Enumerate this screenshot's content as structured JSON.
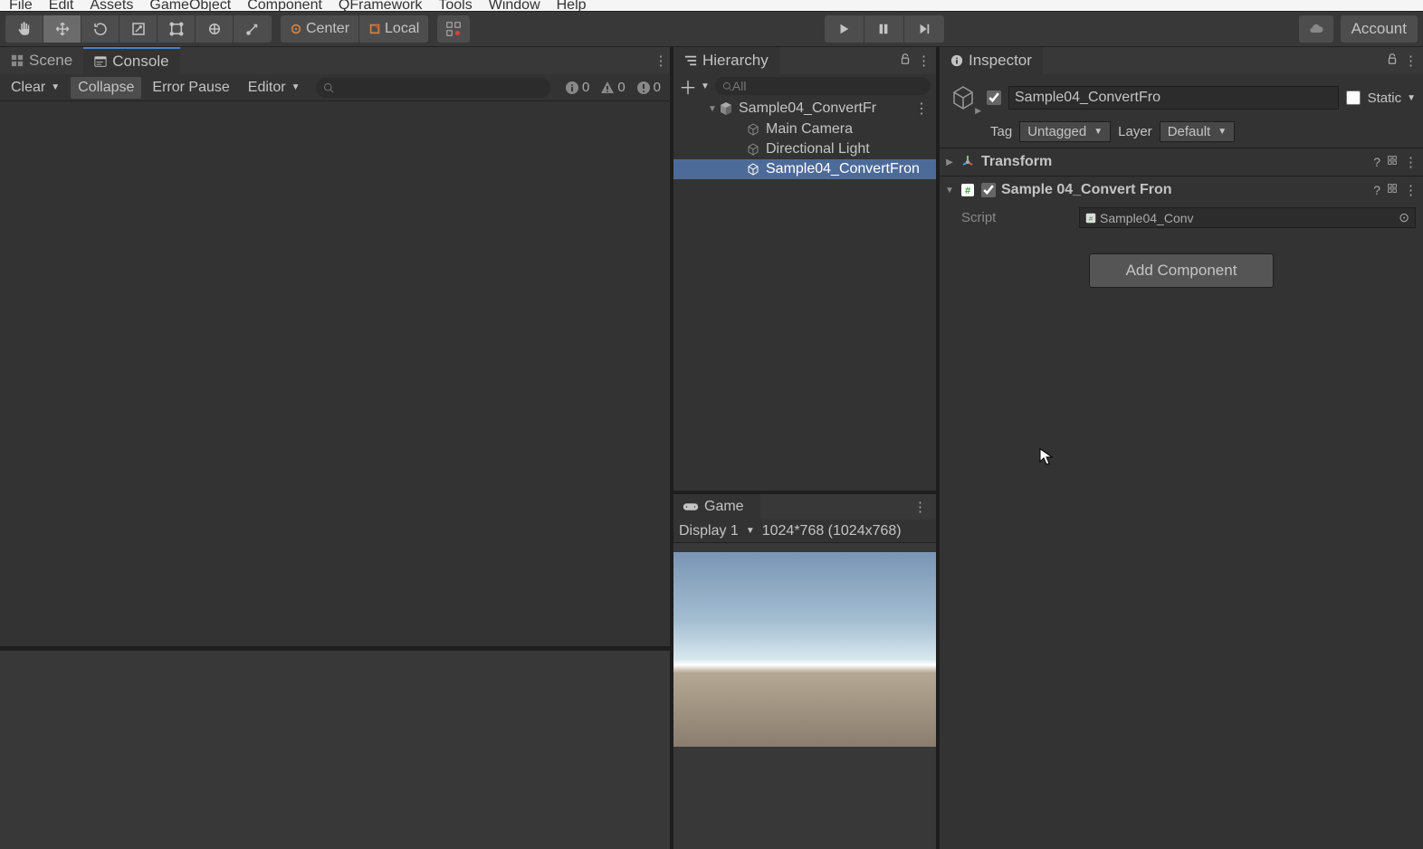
{
  "menu": [
    "File",
    "Edit",
    "Assets",
    "GameObject",
    "Component",
    "QFramework",
    "Tools",
    "Window",
    "Help"
  ],
  "toolbar": {
    "center_label": "Center",
    "local_label": "Local",
    "account_label": "Account"
  },
  "tabs": {
    "scene": "Scene",
    "console": "Console",
    "hierarchy": "Hierarchy",
    "game": "Game",
    "inspector": "Inspector"
  },
  "console": {
    "clear": "Clear",
    "collapse": "Collapse",
    "error_pause": "Error Pause",
    "editor": "Editor",
    "info_count": "0",
    "warn_count": "0",
    "error_count": "0"
  },
  "hierarchy": {
    "search_placeholder": "All",
    "scene": "Sample04_ConvertFr",
    "items": [
      "Main Camera",
      "Directional Light",
      "Sample04_ConvertFron"
    ],
    "selected_index": 2
  },
  "game": {
    "display": "Display 1",
    "resolution": "1024*768 (1024x768)"
  },
  "inspector": {
    "go_name": "Sample04_ConvertFro",
    "go_enabled": true,
    "static_label": "Static",
    "tag_label": "Tag",
    "tag_value": "Untagged",
    "layer_label": "Layer",
    "layer_value": "Default",
    "transform_title": "Transform",
    "script_comp_title": "Sample 04_Convert Fron",
    "script_label": "Script",
    "script_value": "Sample04_Conv",
    "add_component": "Add Component"
  }
}
